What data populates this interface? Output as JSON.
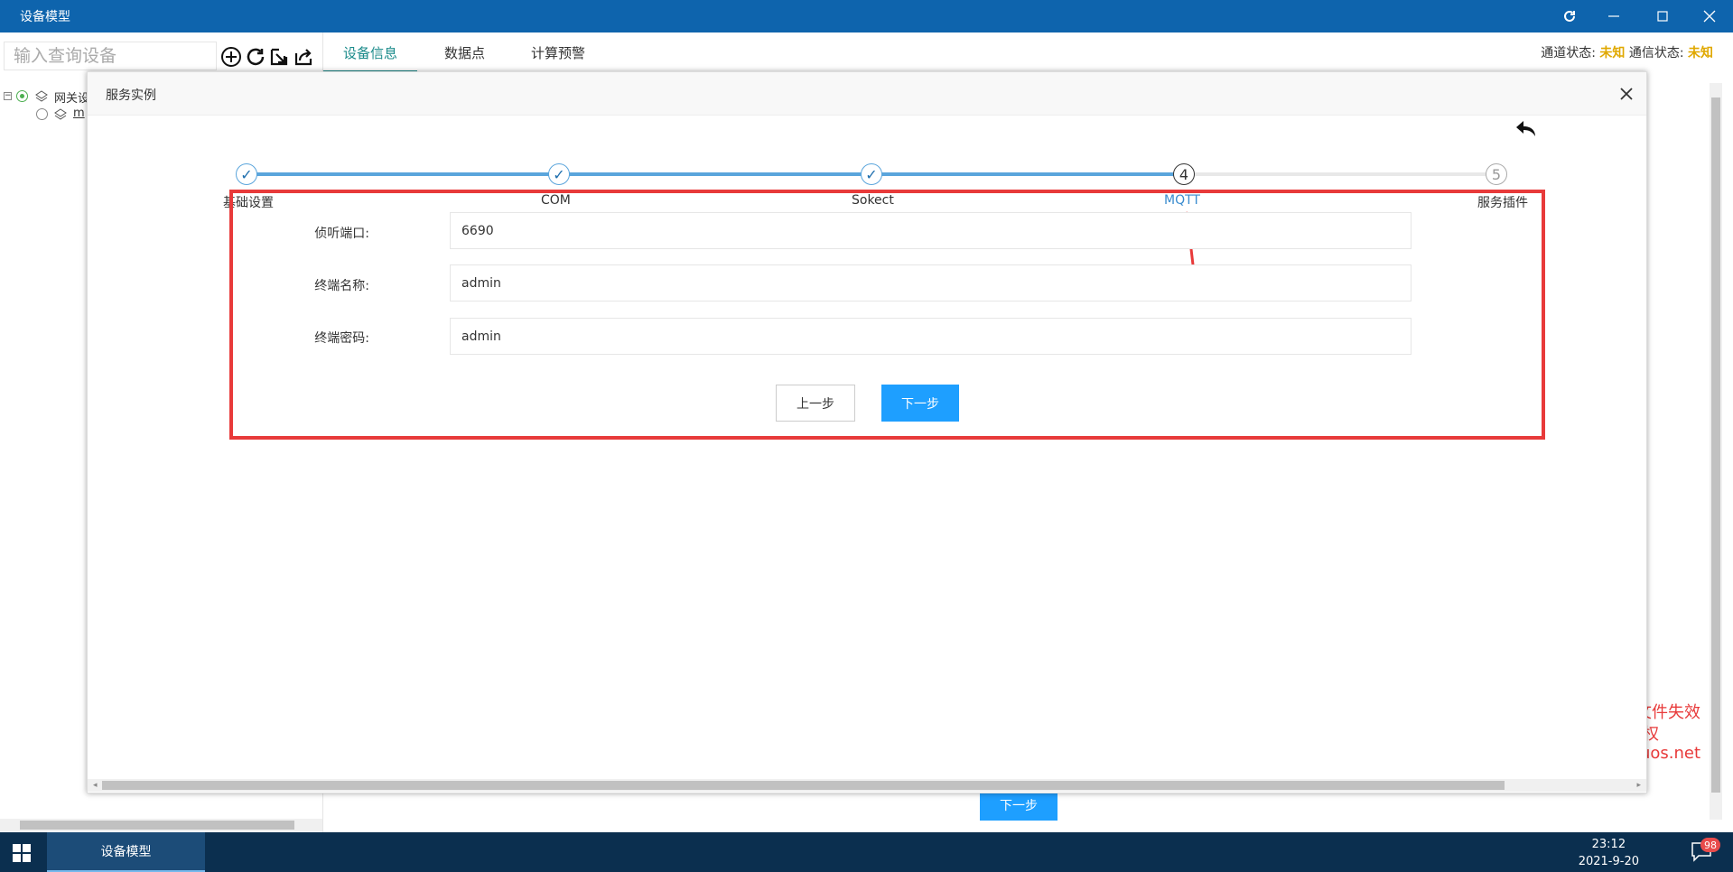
{
  "window": {
    "title": "设备模型"
  },
  "left": {
    "search_placeholder": "输入查询设备",
    "tree": [
      {
        "label": "网关设"
      },
      {
        "label": "m"
      }
    ]
  },
  "tabs": [
    {
      "label": "设备信息",
      "active": true
    },
    {
      "label": "数据点",
      "active": false
    },
    {
      "label": "计算预警",
      "active": false
    }
  ],
  "status": {
    "channel_label": "通道状态:",
    "channel_value": "未知",
    "comm_label": "通信状态:",
    "comm_value": "未知"
  },
  "modal": {
    "title": "服务实例",
    "steps": [
      {
        "label": "基础设置",
        "state": "done",
        "marker": "✓"
      },
      {
        "label": "COM",
        "state": "done",
        "marker": "✓"
      },
      {
        "label": "Sokect",
        "state": "done",
        "marker": "✓"
      },
      {
        "label": "MQTT",
        "state": "current",
        "marker": "4"
      },
      {
        "label": "服务插件",
        "state": "pending",
        "marker": "5"
      }
    ],
    "fields": [
      {
        "label": "侦听端口:",
        "value": "6690"
      },
      {
        "label": "终端名称:",
        "value": "admin"
      },
      {
        "label": "终端密码:",
        "value": "admin"
      }
    ],
    "prev_label": "上一步",
    "next_label": "下一步"
  },
  "behind_next_label": "下一步",
  "watermark": {
    "line1": "文件失效",
    "line2": "权",
    "line3": "uos.net"
  },
  "taskbar": {
    "app_label": "设备模型",
    "time": "23:12",
    "date": "2021-9-20",
    "badge": "98"
  },
  "colors": {
    "titlebar": "#0e64ad",
    "accent": "#1e9fff",
    "step_done": "#5aa5dc",
    "tab_active": "#1a8a8a",
    "warn": "#e0a800",
    "highlight": "#e83a3a",
    "taskbar": "#0b2f4f"
  }
}
